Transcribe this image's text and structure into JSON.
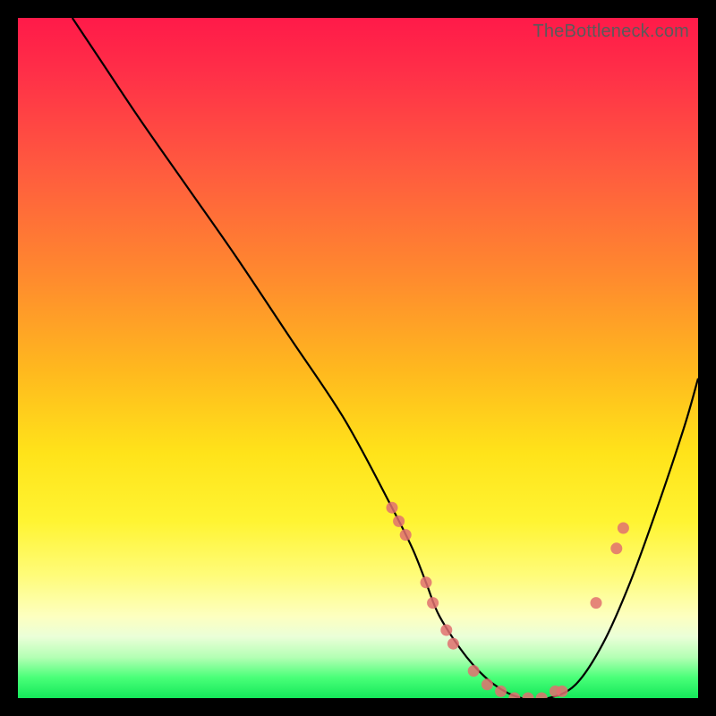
{
  "watermark": "TheBottleneck.com",
  "chart_data": {
    "type": "line",
    "title": "",
    "xlabel": "",
    "ylabel": "",
    "xlim": [
      0,
      100
    ],
    "ylim": [
      0,
      100
    ],
    "series": [
      {
        "name": "curve",
        "x": [
          8,
          12,
          18,
          25,
          32,
          40,
          48,
          55,
          58,
          60,
          62,
          66,
          70,
          74,
          78,
          82,
          86,
          90,
          94,
          98,
          100
        ],
        "y": [
          100,
          94,
          85,
          75,
          65,
          53,
          41,
          28,
          22,
          17,
          12,
          6,
          2,
          0,
          0,
          2,
          8,
          17,
          28,
          40,
          47
        ]
      }
    ],
    "markers": [
      {
        "x": 55,
        "y": 28
      },
      {
        "x": 56,
        "y": 26
      },
      {
        "x": 57,
        "y": 24
      },
      {
        "x": 60,
        "y": 17
      },
      {
        "x": 61,
        "y": 14
      },
      {
        "x": 63,
        "y": 10
      },
      {
        "x": 64,
        "y": 8
      },
      {
        "x": 67,
        "y": 4
      },
      {
        "x": 69,
        "y": 2
      },
      {
        "x": 71,
        "y": 1
      },
      {
        "x": 73,
        "y": 0
      },
      {
        "x": 75,
        "y": 0
      },
      {
        "x": 77,
        "y": 0
      },
      {
        "x": 79,
        "y": 1
      },
      {
        "x": 80,
        "y": 1
      },
      {
        "x": 85,
        "y": 14
      },
      {
        "x": 88,
        "y": 22
      },
      {
        "x": 89,
        "y": 25
      }
    ]
  }
}
